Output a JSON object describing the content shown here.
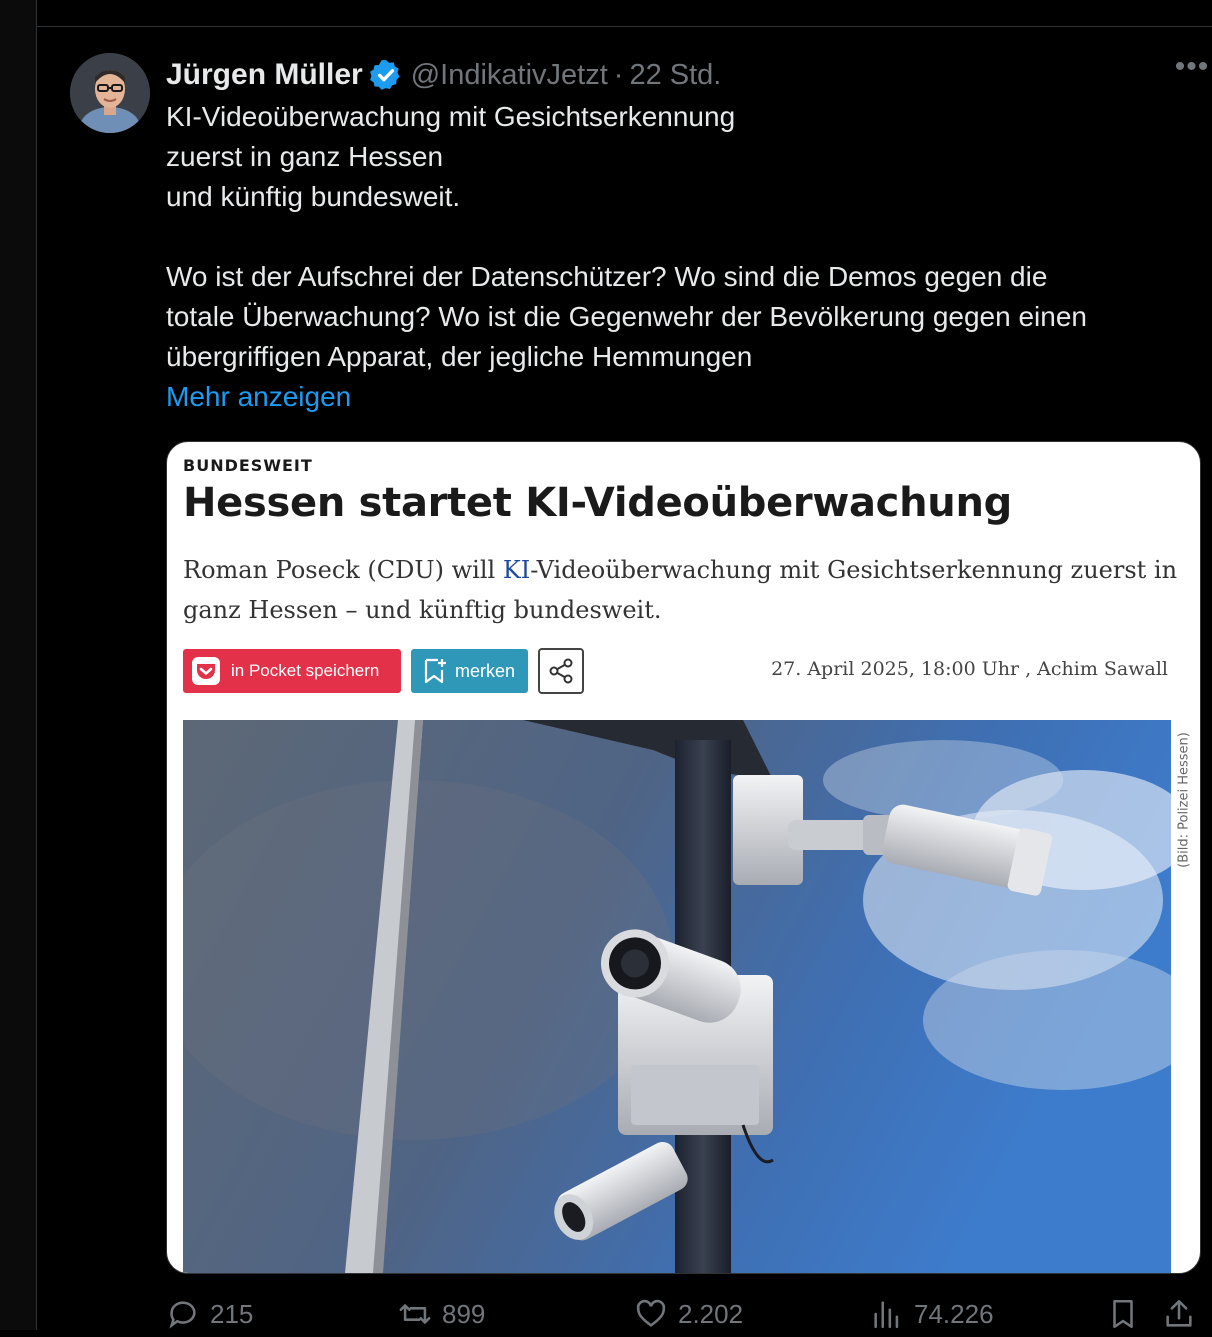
{
  "tweet": {
    "author_name": "Jürgen Müller",
    "handle": "@IndikativJetzt",
    "separator": "·",
    "time": "22 Std.",
    "more_label": "•••",
    "text_lines": [
      "KI-Videoüberwachung mit Gesichtserkennung",
      "zuerst in ganz Hessen",
      "und künftig bundesweit.",
      "",
      "Wo ist der Aufschrei der Datenschützer? Wo sind die Demos gegen die",
      "totale Überwachung? Wo ist die Gegenwehr der Bevölkerung gegen einen",
      "übergriffigen Apparat, der jegliche Hemmungen"
    ],
    "show_more": "Mehr anzeigen",
    "accent_color": "#1d9bf0"
  },
  "card": {
    "kicker": "BUNDESWEIT",
    "headline": "Hessen startet KI-Videoüberwachung",
    "lead_line1_prefix": "Roman Poseck (CDU) will ",
    "lead_line1_ki": "KI",
    "lead_line1_suffix": "-Videoüberwachung mit Gesichtserkennung zuerst in",
    "lead_line2": "ganz Hessen – und künftig bundesweit.",
    "pocket_label": "in Pocket speichern",
    "merken_label": "merken",
    "meta": "27. April 2025, 18:00 Uhr , Achim Sawall",
    "photo_credit": "(Bild: Polizei Hessen)",
    "pocket_color": "#e23148",
    "merken_color": "#2f98b8"
  },
  "actions": {
    "replies": "215",
    "reposts": "899",
    "likes": "2.202",
    "views": "74.226"
  }
}
